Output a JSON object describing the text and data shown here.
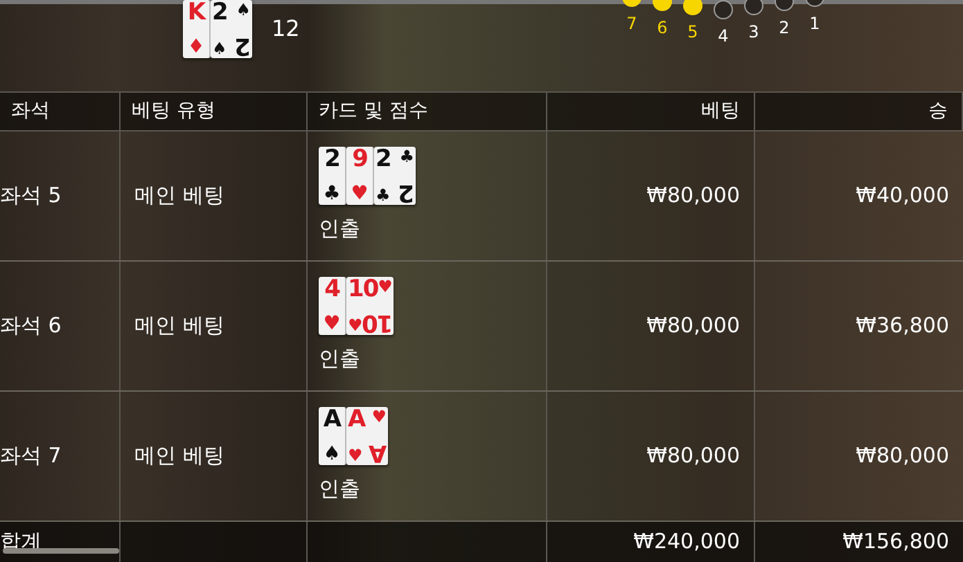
{
  "top_hand": {
    "cards": [
      {
        "kind": "partial",
        "rank": "K",
        "suit": "♦",
        "red": true
      },
      {
        "kind": "full",
        "rank": "2",
        "suit": "♠",
        "suit_2": "♠",
        "rank_2": "2",
        "red": false
      }
    ],
    "score": "12"
  },
  "road": [
    {
      "label": "7",
      "lit": true
    },
    {
      "label": "6",
      "lit": true
    },
    {
      "label": "5",
      "lit": true
    },
    {
      "label": "4",
      "lit": false
    },
    {
      "label": "3",
      "lit": false
    },
    {
      "label": "2",
      "lit": false
    },
    {
      "label": "1",
      "lit": false
    }
  ],
  "table": {
    "columns": [
      "좌석",
      "베팅 유형",
      "카드 및 점수",
      "베팅",
      "승"
    ],
    "rows": [
      {
        "seat": "좌석 5",
        "bet_type": "메인 베팅",
        "cards": [
          {
            "kind": "partial",
            "rank": "2",
            "suit": "♣",
            "red": false
          },
          {
            "kind": "partial",
            "rank": "9",
            "suit": "♥",
            "red": true
          },
          {
            "kind": "full",
            "rank": "2",
            "suit": "♣",
            "suit_2": "♣",
            "rank_2": "2",
            "red": false
          }
        ],
        "result": "인출",
        "bet": "₩80,000",
        "win": "₩40,000"
      },
      {
        "seat": "좌석 6",
        "bet_type": "메인 베팅",
        "cards": [
          {
            "kind": "partial",
            "rank": "4",
            "suit": "♥",
            "red": true
          },
          {
            "kind": "full",
            "rank": "10",
            "suit": "♥",
            "suit_2": "♥",
            "rank_2": "10",
            "red": true
          }
        ],
        "result": "인출",
        "bet": "₩80,000",
        "win": "₩36,800"
      },
      {
        "seat": "좌석 7",
        "bet_type": "메인 베팅",
        "cards": [
          {
            "kind": "partial",
            "rank": "A",
            "suit": "♠",
            "red": false
          },
          {
            "kind": "full",
            "rank": "A",
            "suit": "♥",
            "suit_2": "♥",
            "rank_2": "A",
            "red": true
          }
        ],
        "result": "인출",
        "bet": "₩80,000",
        "win": "₩80,000"
      }
    ],
    "footer": {
      "label": "합계",
      "bet": "₩240,000",
      "win": "₩156,800"
    }
  }
}
